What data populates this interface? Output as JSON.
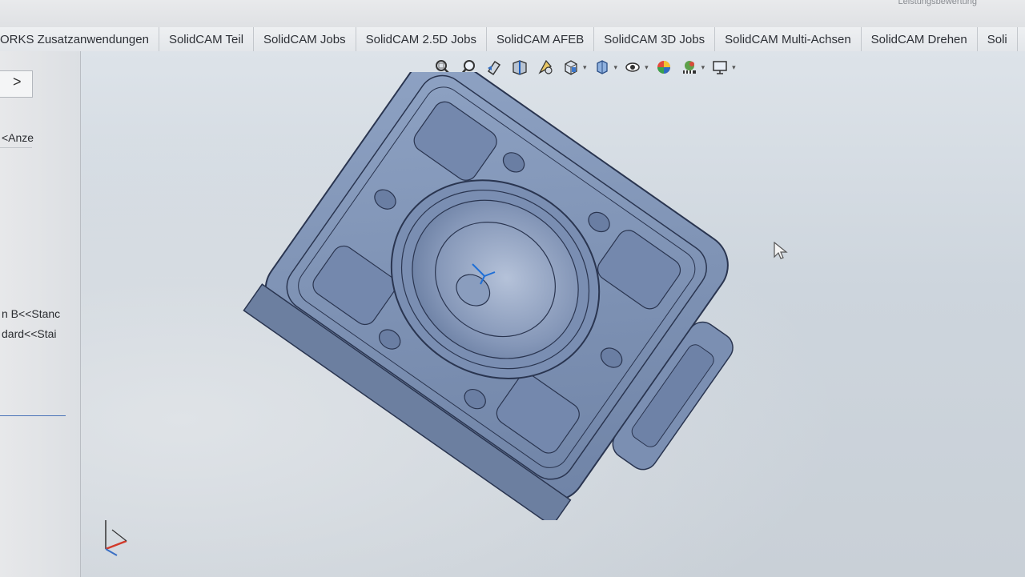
{
  "top": {
    "corner_text": "Leistungsbewertung"
  },
  "tabs": [
    "ORKS Zusatzanwendungen",
    "SolidCAM Teil",
    "SolidCAM Jobs",
    "SolidCAM 2.5D Jobs",
    "SolidCAM AFEB",
    "SolidCAM 3D Jobs",
    "SolidCAM Multi-Achsen",
    "SolidCAM Drehen",
    "Soli"
  ],
  "left_panel": {
    "expand_arrow": ">",
    "display_state": "<Anze",
    "config_a": "n B<<Stanc",
    "config_b": "dard<<Stai"
  },
  "hud_icons": [
    "zoom-to-fit-icon",
    "zoom-to-area-icon",
    "previous-view-icon",
    "section-view-icon",
    "dynamic-annotation-icon",
    "view-orientation-icon",
    "display-style-icon",
    "hide-show-items-icon",
    "edit-appearance-icon",
    "apply-scene-icon",
    "view-settings-icon"
  ],
  "colors": {
    "part": "#7f93b5",
    "accent": "#4b74b8"
  }
}
